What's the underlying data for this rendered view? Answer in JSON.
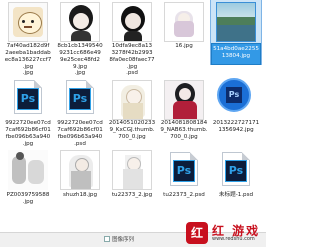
{
  "files": [
    {
      "label": "7af40ad182d9f\n2aeeba1baddab\nec8a136227ccf7\n.jpg"
    },
    {
      "label": "8cb1cb1349540\n9231cc686e49\n9e25cec48fd2\n9.jpg"
    },
    {
      "label": "10dfa9ec8a13\n3278f42b2993\n8fa0ec08faec77\n.jpg"
    },
    {
      "label": "16.jpg"
    },
    {
      "label": "51a4bd0ae2255\n13804.jpg"
    },
    {
      "label": ".jpg"
    },
    {
      "label": ".jpg"
    },
    {
      "label": ".psd"
    },
    {
      "label": "9922720ee07cd\n7caf692b86cf01\nfbe096b63a940\n.jpg"
    },
    {
      "label": "9922720ee07cd\n7caf692b86cf01\nfbe096b63a940\n.psd"
    },
    {
      "label": "2014051020233\n9_KxCGJ.thumb.\n700_0.jpg"
    },
    {
      "label": "2014081808184\n9_NAB63.thumb.\n700_0.jpg"
    },
    {
      "label": "2013222727171\n1356942.jpg"
    },
    {
      "label": "PZ0039759588\n.jpg"
    },
    {
      "label": "shuzh18.jpg"
    },
    {
      "label": "tu22373_2.jpg"
    },
    {
      "label": "tu22373_2.psd"
    },
    {
      "label": "未标题-1.psd"
    }
  ],
  "status": {
    "label": "图像序列"
  },
  "watermark": {
    "logo": "红",
    "title": "红 游戏",
    "url": "www.redshu.com"
  }
}
